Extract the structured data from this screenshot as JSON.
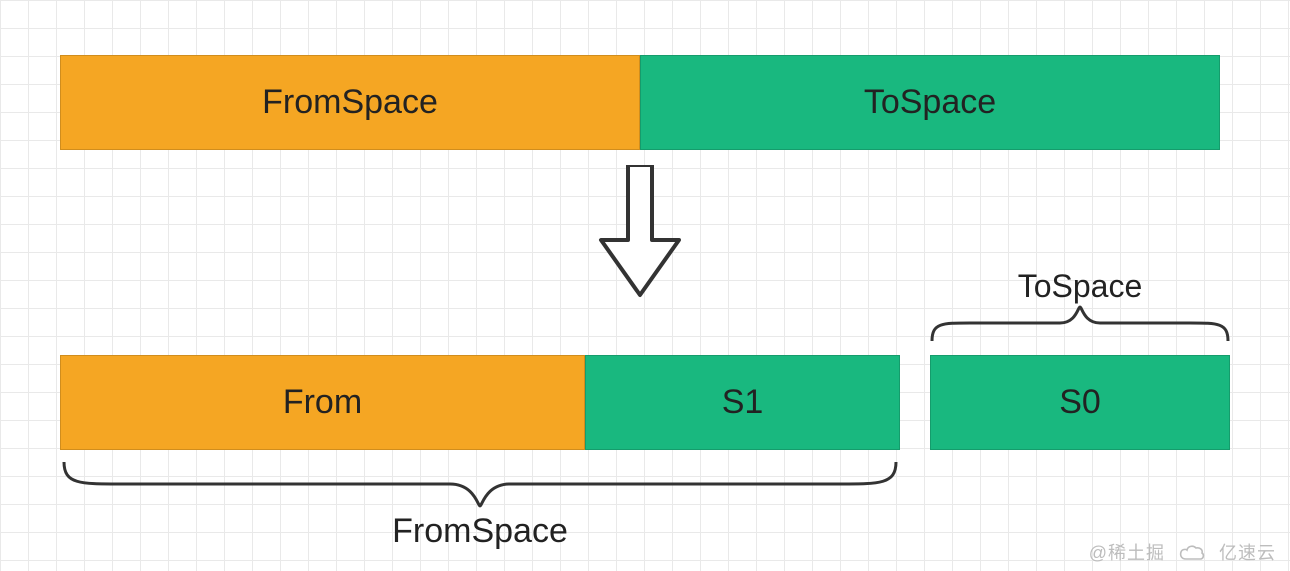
{
  "top_row": {
    "left": {
      "label": "FromSpace",
      "color": "orange"
    },
    "right": {
      "label": "ToSpace",
      "color": "green"
    }
  },
  "bottom_row": {
    "b1": {
      "label": "From",
      "color": "orange"
    },
    "b2": {
      "label": "S1",
      "color": "green"
    },
    "b3": {
      "label": "S0",
      "color": "green"
    }
  },
  "braces": {
    "top_label": "ToSpace",
    "bottom_label": "FromSpace"
  },
  "watermark": {
    "left": "@稀土掘",
    "right": "亿速云"
  },
  "colors": {
    "orange": "#f5a623",
    "green": "#19b87f",
    "stroke": "#333333"
  }
}
